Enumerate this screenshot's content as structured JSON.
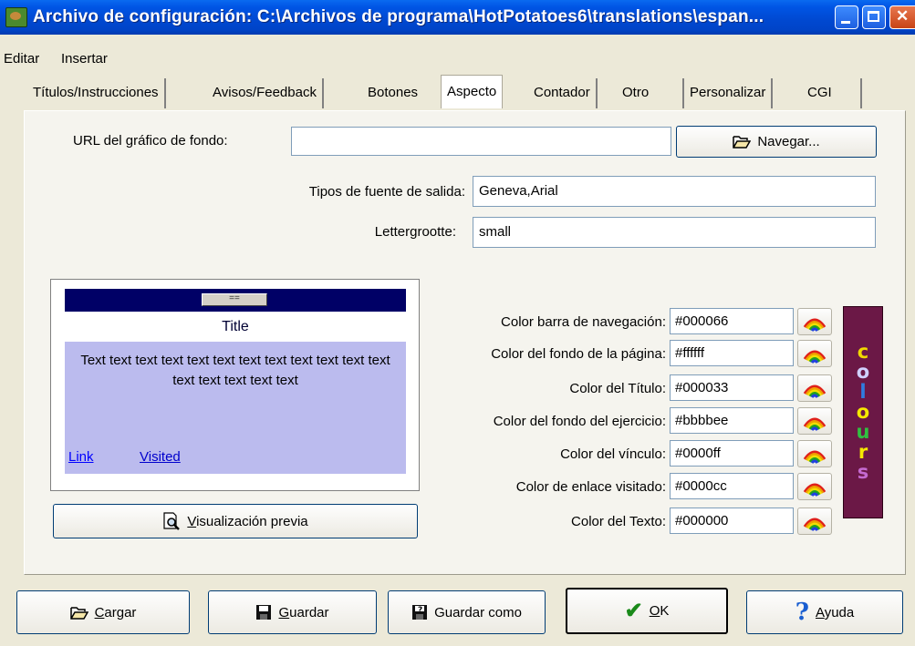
{
  "window": {
    "title": "Archivo de configuración: C:\\Archivos de programa\\HotPotatoes6\\translations\\espan..."
  },
  "menu": [
    "Editar",
    "Insertar"
  ],
  "tabs": [
    "Títulos/Instrucciones",
    "Avisos/Feedback",
    "Botones",
    "Aspecto",
    "Contador",
    "Otro",
    "Personalizar",
    "CGI"
  ],
  "active_tab": "Aspecto",
  "form": {
    "bg_url_label": "URL del gráfico de fondo:",
    "bg_url_value": "",
    "browse_label": "Navegar...",
    "fonts_label": "Tipos de fuente de salida:",
    "fonts_value": "Geneva,Arial",
    "size_label": "Lettergrootte:",
    "size_value": "small"
  },
  "preview": {
    "nav_button": "==",
    "title": "Title",
    "text": "Text text text text text text text text text text text text text text text text text",
    "link": "Link",
    "visited": "Visited",
    "button_label": "Visualización previa",
    "button_mnemonic": "V"
  },
  "colors": [
    {
      "label": "Color barra de navegación:",
      "value": "#000066"
    },
    {
      "label": "Color del fondo de la página:",
      "value": "#ffffff"
    },
    {
      "label": "Color del Título:",
      "value": "#000033"
    },
    {
      "label": "Color del fondo del ejercicio:",
      "value": "#bbbbee"
    },
    {
      "label": "Color del vínculo:",
      "value": "#0000ff"
    },
    {
      "label": "Color de enlace visitado:",
      "value": "#0000cc"
    },
    {
      "label": "Color del Texto:",
      "value": "#000000"
    }
  ],
  "colours_logo": [
    "c",
    "o",
    "l",
    "o",
    "u",
    "r",
    "s"
  ],
  "colours_logo_colors": [
    "#f0d800",
    "#d0d0ff",
    "#2f7ce0",
    "#f5e800",
    "#30c040",
    "#f5e800",
    "#c56ad0"
  ],
  "buttons": {
    "load": {
      "label": "Cargar",
      "mnemonic": "C"
    },
    "save": {
      "label": "Guardar",
      "mnemonic": "G"
    },
    "save_as": {
      "label": "Guardar como"
    },
    "ok": {
      "label": "OK",
      "mnemonic": "O"
    },
    "help": {
      "label": "Ayuda",
      "mnemonic": "A"
    }
  }
}
